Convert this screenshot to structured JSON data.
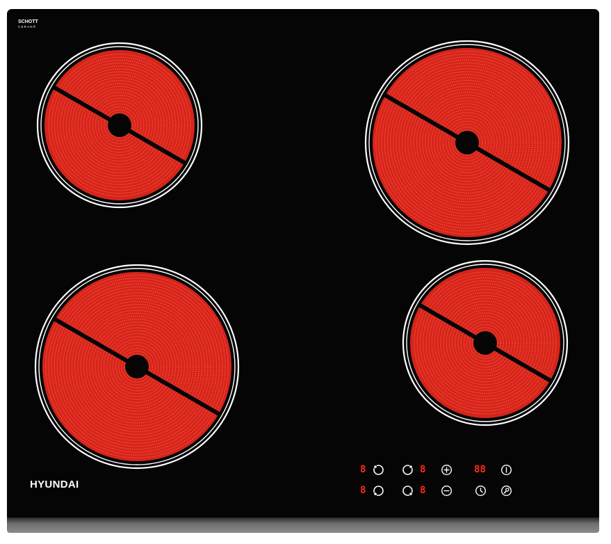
{
  "logo": {
    "line1": "SCHOTT",
    "line2": "CERAN®"
  },
  "brand": "HYUNDAI",
  "colors": {
    "glass": "#050505",
    "element": "#d4251b",
    "coil": "#ff4a3a",
    "display": "#ff2a1a",
    "ring": "#ffffff"
  },
  "zones": [
    {
      "name": "rear-left"
    },
    {
      "name": "rear-right"
    },
    {
      "name": "front-left"
    },
    {
      "name": "front-right"
    }
  ],
  "controls": {
    "displays": {
      "zone_top_left": "8",
      "zone_bottom_left": "8",
      "zone_top_right": "8",
      "zone_bottom_right": "8",
      "timer": "88"
    },
    "icons": [
      "rear-left-zone-icon",
      "front-left-zone-icon",
      "rear-right-zone-icon",
      "front-right-zone-icon",
      "plus-icon",
      "minus-icon",
      "power-icon",
      "timer-icon",
      "lock-icon"
    ]
  }
}
